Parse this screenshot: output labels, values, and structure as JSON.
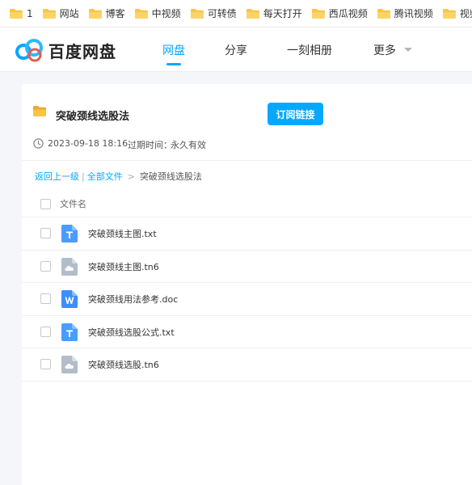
{
  "bookmarks": [
    {
      "label": "1"
    },
    {
      "label": "网站"
    },
    {
      "label": "博客"
    },
    {
      "label": "中视频"
    },
    {
      "label": "可转债"
    },
    {
      "label": "每天打开"
    },
    {
      "label": "西瓜视频"
    },
    {
      "label": "腾讯视频"
    },
    {
      "label": "视频"
    }
  ],
  "header": {
    "logo_text": "百度网盘",
    "nav": [
      "网盘",
      "分享",
      "一刻相册",
      "更多"
    ],
    "active_nav": "网盘"
  },
  "share": {
    "title": "突破颈线选股法",
    "subscribe_label": "订阅链接",
    "date": "2023-09-18 18:16",
    "expire_label": "过期时间：",
    "expire_value": "永久有效"
  },
  "breadcrumb": {
    "back": "返回上一级",
    "all_files": "全部文件",
    "current": "突破颈线选股法"
  },
  "list": {
    "column_name": "文件名",
    "files": [
      {
        "name": "突破颈线主图.txt",
        "icon": "txt-file-icon"
      },
      {
        "name": "突破颈线主图.tn6",
        "icon": "cloud-file-icon"
      },
      {
        "name": "突破颈线用法参考.doc",
        "icon": "word-file-icon"
      },
      {
        "name": "突破颈线选股公式.txt",
        "icon": "txt-file-icon"
      },
      {
        "name": "突破颈线选股.tn6",
        "icon": "cloud-file-icon"
      }
    ]
  },
  "colors": {
    "accent": "#06a7ff",
    "folder": "#f9c543",
    "txt_icon": "#4b9cff",
    "word_icon": "#3c8dff",
    "cloud_icon": "#b3bdc9"
  }
}
